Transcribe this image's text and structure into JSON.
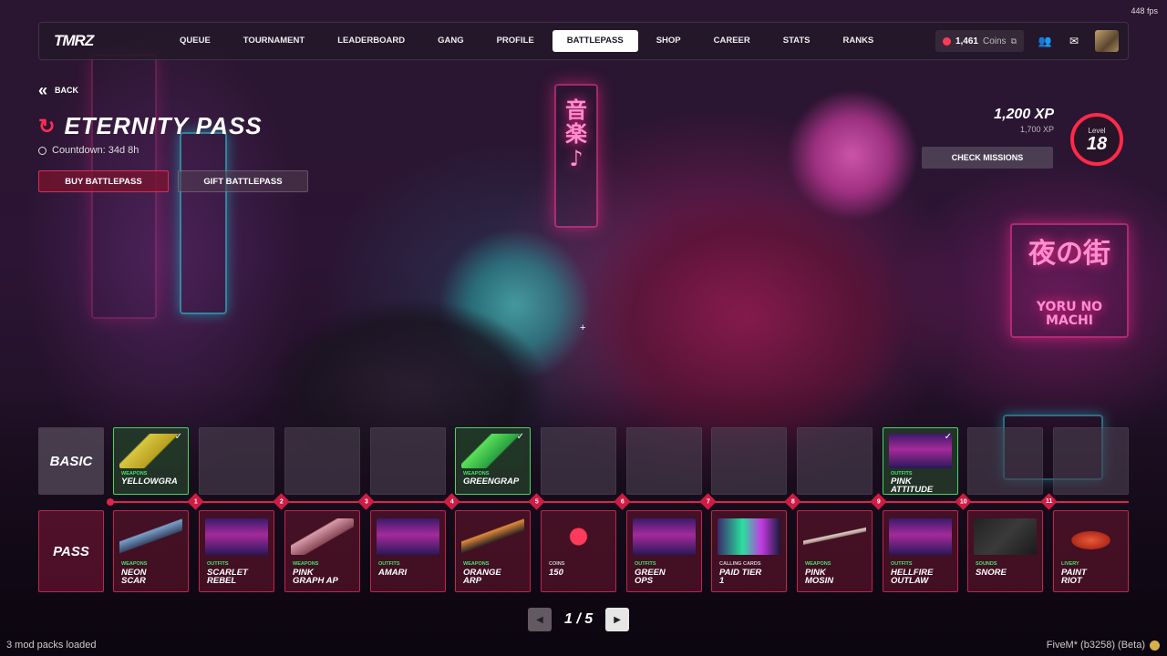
{
  "overlay": {
    "fps": "448 fps"
  },
  "navbar": {
    "logo": "TMRZ",
    "items": [
      "QUEUE",
      "TOURNAMENT",
      "LEADERBOARD",
      "GANG",
      "PROFILE",
      "BATTLEPASS",
      "SHOP",
      "CAREER",
      "STATS",
      "RANKS"
    ],
    "active": "BATTLEPASS",
    "coins_value": "1,461",
    "coins_label": "Coins"
  },
  "header": {
    "back_label": "BACK",
    "title": "ETERNITY PASS",
    "countdown": "Countdown: 34d 8h",
    "buy_label": "BUY BATTLEPASS",
    "gift_label": "GIFT BATTLEPASS",
    "xp_current": "1,200 XP",
    "xp_max": "1,700 XP",
    "missions_label": "CHECK MISSIONS",
    "level_label": "Level",
    "level_value": "18"
  },
  "track": {
    "basic_label": "BASIC",
    "pass_label": "PASS",
    "basic": [
      {
        "category": "WEAPONS",
        "name": "YELLOWGRA",
        "owned": true
      },
      {
        "category": "",
        "name": "",
        "owned": false
      },
      {
        "category": "",
        "name": "",
        "owned": false
      },
      {
        "category": "",
        "name": "",
        "owned": false
      },
      {
        "category": "WEAPONS",
        "name": "GREENGRAP",
        "owned": true
      },
      {
        "category": "",
        "name": "",
        "owned": false
      },
      {
        "category": "",
        "name": "",
        "owned": false
      },
      {
        "category": "",
        "name": "",
        "owned": false
      },
      {
        "category": "",
        "name": "",
        "owned": false
      },
      {
        "category": "OUTFITS",
        "name": "PINK\nATTITUDE",
        "owned": true
      },
      {
        "category": "",
        "name": "",
        "owned": false
      },
      {
        "category": "",
        "name": "",
        "owned": false
      }
    ],
    "tiers": [
      "1",
      "2",
      "3",
      "4",
      "5",
      "6",
      "7",
      "8",
      "9",
      "10",
      "11"
    ],
    "pass": [
      {
        "category": "WEAPONS",
        "name": "NEON\nSCAR"
      },
      {
        "category": "OUTFITS",
        "name": "SCARLET\nREBEL"
      },
      {
        "category": "WEAPONS",
        "name": "PINK\nGRAPH AP"
      },
      {
        "category": "OUTFITS",
        "name": "AMARI"
      },
      {
        "category": "WEAPONS",
        "name": "ORANGE\nARP"
      },
      {
        "category": "COINS",
        "name": "150"
      },
      {
        "category": "OUTFITS",
        "name": "GREEN\nOPS"
      },
      {
        "category": "CALLING CARDS",
        "name": "PAID TIER\n1"
      },
      {
        "category": "WEAPONS",
        "name": "PINK\nMOSIN"
      },
      {
        "category": "OUTFITS",
        "name": "HELLFIRE\nOUTLAW"
      },
      {
        "category": "SOUNDS",
        "name": "SNORE"
      },
      {
        "category": "LIVERY",
        "name": "PAINT\nRIOT"
      }
    ]
  },
  "pager": {
    "label": "1 / 5",
    "prev": "◀",
    "next": "▶"
  },
  "footer": {
    "left": "3 mod packs loaded",
    "right": "FiveM* (b3258) (Beta)"
  }
}
